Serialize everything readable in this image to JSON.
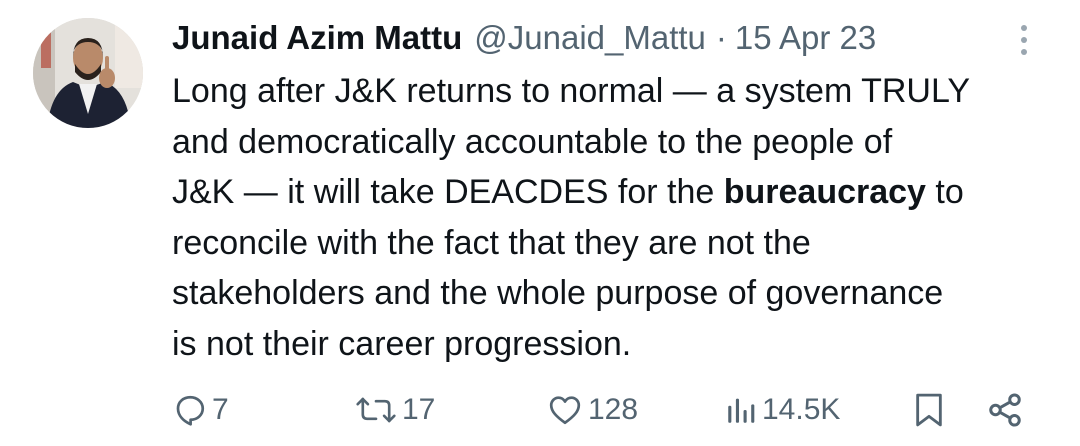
{
  "author": {
    "display_name": "Junaid Azim Mattu",
    "handle": "@Junaid_Mattu",
    "separator": "·",
    "date": "15 Apr 23"
  },
  "tweet": {
    "lines": [
      "Long after J&K returns to normal — a system TRULY",
      "and democratically accountable to the people of",
      "J&K — it will take DEACDES for the ",
      "bureaucracy",
      " to",
      "reconcile with the fact that they are not the",
      "stakeholders and the whole purpose of governance",
      "is not their career progression."
    ]
  },
  "actions": {
    "replies": "7",
    "reposts": "17",
    "likes": "128",
    "views": "14.5K"
  },
  "icons": {
    "more": "more-vertical-icon",
    "reply": "reply-icon",
    "repost": "repost-icon",
    "like": "heart-icon",
    "views": "views-icon",
    "bookmark": "bookmark-icon",
    "share": "share-icon"
  },
  "colors": {
    "text": "#0f1419",
    "secondary": "#536471"
  }
}
